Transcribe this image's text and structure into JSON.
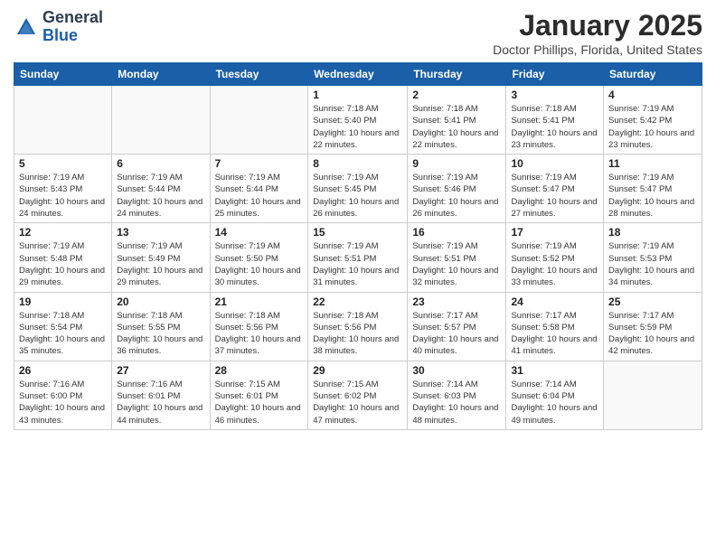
{
  "logo": {
    "general": "General",
    "blue": "Blue"
  },
  "title": "January 2025",
  "subtitle": "Doctor Phillips, Florida, United States",
  "days_of_week": [
    "Sunday",
    "Monday",
    "Tuesday",
    "Wednesday",
    "Thursday",
    "Friday",
    "Saturday"
  ],
  "weeks": [
    [
      {
        "day": "",
        "info": ""
      },
      {
        "day": "",
        "info": ""
      },
      {
        "day": "",
        "info": ""
      },
      {
        "day": "1",
        "info": "Sunrise: 7:18 AM\nSunset: 5:40 PM\nDaylight: 10 hours\nand 22 minutes."
      },
      {
        "day": "2",
        "info": "Sunrise: 7:18 AM\nSunset: 5:41 PM\nDaylight: 10 hours\nand 22 minutes."
      },
      {
        "day": "3",
        "info": "Sunrise: 7:18 AM\nSunset: 5:41 PM\nDaylight: 10 hours\nand 23 minutes."
      },
      {
        "day": "4",
        "info": "Sunrise: 7:19 AM\nSunset: 5:42 PM\nDaylight: 10 hours\nand 23 minutes."
      }
    ],
    [
      {
        "day": "5",
        "info": "Sunrise: 7:19 AM\nSunset: 5:43 PM\nDaylight: 10 hours\nand 24 minutes."
      },
      {
        "day": "6",
        "info": "Sunrise: 7:19 AM\nSunset: 5:44 PM\nDaylight: 10 hours\nand 24 minutes."
      },
      {
        "day": "7",
        "info": "Sunrise: 7:19 AM\nSunset: 5:44 PM\nDaylight: 10 hours\nand 25 minutes."
      },
      {
        "day": "8",
        "info": "Sunrise: 7:19 AM\nSunset: 5:45 PM\nDaylight: 10 hours\nand 26 minutes."
      },
      {
        "day": "9",
        "info": "Sunrise: 7:19 AM\nSunset: 5:46 PM\nDaylight: 10 hours\nand 26 minutes."
      },
      {
        "day": "10",
        "info": "Sunrise: 7:19 AM\nSunset: 5:47 PM\nDaylight: 10 hours\nand 27 minutes."
      },
      {
        "day": "11",
        "info": "Sunrise: 7:19 AM\nSunset: 5:47 PM\nDaylight: 10 hours\nand 28 minutes."
      }
    ],
    [
      {
        "day": "12",
        "info": "Sunrise: 7:19 AM\nSunset: 5:48 PM\nDaylight: 10 hours\nand 29 minutes."
      },
      {
        "day": "13",
        "info": "Sunrise: 7:19 AM\nSunset: 5:49 PM\nDaylight: 10 hours\nand 29 minutes."
      },
      {
        "day": "14",
        "info": "Sunrise: 7:19 AM\nSunset: 5:50 PM\nDaylight: 10 hours\nand 30 minutes."
      },
      {
        "day": "15",
        "info": "Sunrise: 7:19 AM\nSunset: 5:51 PM\nDaylight: 10 hours\nand 31 minutes."
      },
      {
        "day": "16",
        "info": "Sunrise: 7:19 AM\nSunset: 5:51 PM\nDaylight: 10 hours\nand 32 minutes."
      },
      {
        "day": "17",
        "info": "Sunrise: 7:19 AM\nSunset: 5:52 PM\nDaylight: 10 hours\nand 33 minutes."
      },
      {
        "day": "18",
        "info": "Sunrise: 7:19 AM\nSunset: 5:53 PM\nDaylight: 10 hours\nand 34 minutes."
      }
    ],
    [
      {
        "day": "19",
        "info": "Sunrise: 7:18 AM\nSunset: 5:54 PM\nDaylight: 10 hours\nand 35 minutes."
      },
      {
        "day": "20",
        "info": "Sunrise: 7:18 AM\nSunset: 5:55 PM\nDaylight: 10 hours\nand 36 minutes."
      },
      {
        "day": "21",
        "info": "Sunrise: 7:18 AM\nSunset: 5:56 PM\nDaylight: 10 hours\nand 37 minutes."
      },
      {
        "day": "22",
        "info": "Sunrise: 7:18 AM\nSunset: 5:56 PM\nDaylight: 10 hours\nand 38 minutes."
      },
      {
        "day": "23",
        "info": "Sunrise: 7:17 AM\nSunset: 5:57 PM\nDaylight: 10 hours\nand 40 minutes."
      },
      {
        "day": "24",
        "info": "Sunrise: 7:17 AM\nSunset: 5:58 PM\nDaylight: 10 hours\nand 41 minutes."
      },
      {
        "day": "25",
        "info": "Sunrise: 7:17 AM\nSunset: 5:59 PM\nDaylight: 10 hours\nand 42 minutes."
      }
    ],
    [
      {
        "day": "26",
        "info": "Sunrise: 7:16 AM\nSunset: 6:00 PM\nDaylight: 10 hours\nand 43 minutes."
      },
      {
        "day": "27",
        "info": "Sunrise: 7:16 AM\nSunset: 6:01 PM\nDaylight: 10 hours\nand 44 minutes."
      },
      {
        "day": "28",
        "info": "Sunrise: 7:15 AM\nSunset: 6:01 PM\nDaylight: 10 hours\nand 46 minutes."
      },
      {
        "day": "29",
        "info": "Sunrise: 7:15 AM\nSunset: 6:02 PM\nDaylight: 10 hours\nand 47 minutes."
      },
      {
        "day": "30",
        "info": "Sunrise: 7:14 AM\nSunset: 6:03 PM\nDaylight: 10 hours\nand 48 minutes."
      },
      {
        "day": "31",
        "info": "Sunrise: 7:14 AM\nSunset: 6:04 PM\nDaylight: 10 hours\nand 49 minutes."
      },
      {
        "day": "",
        "info": ""
      }
    ]
  ]
}
